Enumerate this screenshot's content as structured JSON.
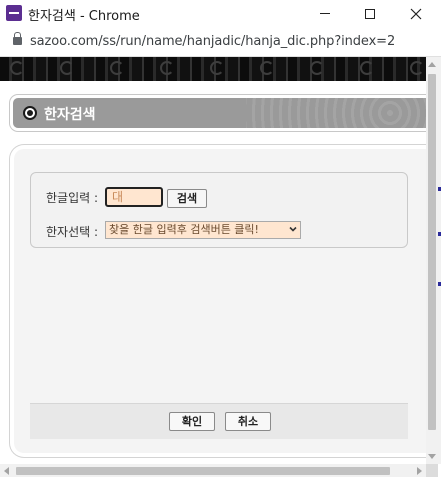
{
  "window": {
    "title": "한자검색 - Chrome",
    "url": "sazoo.com/ss/run/name/hanjadic/hanja_dic.php?index=2"
  },
  "header": {
    "title": "한자검색"
  },
  "form": {
    "hangul_label": "한글입력 :",
    "hangul_value": "대",
    "search_label": "검색",
    "hanja_label": "한자선택 :",
    "hanja_selected": "찾을 한글 입력후 검색버튼 클릭!"
  },
  "footer": {
    "ok_label": "확인",
    "cancel_label": "취소"
  },
  "colors": {
    "header_bg": "#9a9a9a",
    "input_bg": "#ffe6d0",
    "panel_bg": "#f4f4f4"
  },
  "icons": [
    "app-icon",
    "lock-icon",
    "bullet-icon",
    "chevron-down-icon"
  ]
}
